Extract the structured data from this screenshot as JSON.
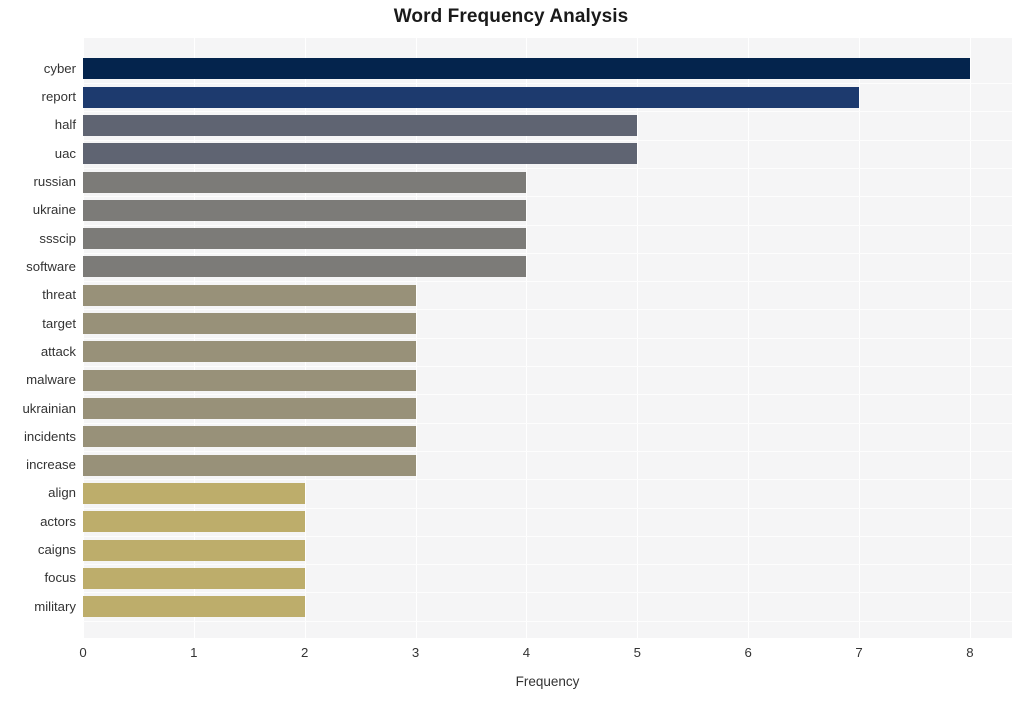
{
  "chart_data": {
    "type": "bar",
    "orientation": "horizontal",
    "title": "Word Frequency Analysis",
    "xlabel": "Frequency",
    "ylabel": "",
    "categories": [
      "cyber",
      "report",
      "half",
      "uac",
      "russian",
      "ukraine",
      "ssscip",
      "software",
      "threat",
      "target",
      "attack",
      "malware",
      "ukrainian",
      "incidents",
      "increase",
      "align",
      "actors",
      "caigns",
      "focus",
      "military"
    ],
    "values": [
      8,
      7,
      5,
      5,
      4,
      4,
      4,
      4,
      3,
      3,
      3,
      3,
      3,
      3,
      3,
      2,
      2,
      2,
      2,
      2
    ],
    "bar_colors": [
      "#04244d",
      "#1d3a6e",
      "#5f6472",
      "#5f6472",
      "#7c7b78",
      "#7c7b78",
      "#7c7b78",
      "#7c7b78",
      "#989179",
      "#989179",
      "#989179",
      "#989179",
      "#989179",
      "#989179",
      "#989179",
      "#bdad6b",
      "#bdad6b",
      "#bdad6b",
      "#bdad6b",
      "#bdad6b"
    ],
    "xlim": [
      0,
      8.38
    ],
    "xticks": [
      0,
      1,
      2,
      3,
      4,
      5,
      6,
      7,
      8
    ],
    "xtick_labels": [
      "0",
      "1",
      "2",
      "3",
      "4",
      "5",
      "6",
      "7",
      "8"
    ],
    "grid": true,
    "grid_color": "#ffffff",
    "plot_background": "#f5f5f6",
    "figure_background": "#ffffff",
    "legend": null
  }
}
